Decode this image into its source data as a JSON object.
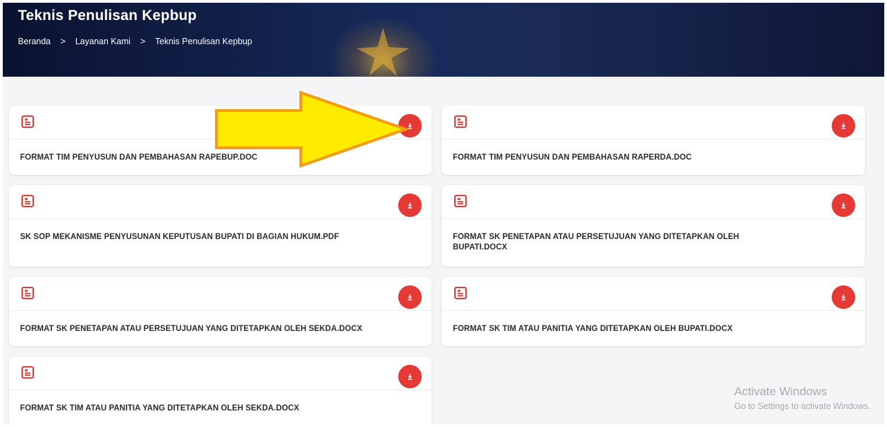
{
  "hero": {
    "title": "Teknis Penulisan Kepbup",
    "breadcrumb": [
      "Beranda",
      "Layanan Kami",
      "Teknis Penulisan Kepbup"
    ],
    "separator": ">"
  },
  "documents": [
    {
      "title": "FORMAT TIM PENYUSUN DAN PEMBAHASAN RAPEBUP.DOC",
      "icon": "document-icon",
      "action": "download-icon"
    },
    {
      "title": "FORMAT TIM PENYUSUN DAN PEMBAHASAN RAPERDA.DOC",
      "icon": "document-icon",
      "action": "download-icon"
    },
    {
      "title": "SK SOP MEKANISME PENYUSUNAN KEPUTUSAN BUPATI DI BAGIAN HUKUM.PDF",
      "icon": "document-icon",
      "action": "download-icon"
    },
    {
      "title": "FORMAT SK PENETAPAN ATAU PERSETUJUAN YANG DITETAPKAN OLEH BUPATI.DOCX",
      "icon": "document-icon",
      "action": "download-icon"
    },
    {
      "title": "FORMAT SK PENETAPAN ATAU PERSETUJUAN YANG DITETAPKAN OLEH SEKDA.DOCX",
      "icon": "document-icon",
      "action": "download-icon"
    },
    {
      "title": "FORMAT SK TIM ATAU PANITIA YANG DITETAPKAN OLEH BUPATI.DOCX",
      "icon": "document-icon",
      "action": "download-icon"
    },
    {
      "title": "FORMAT SK TIM ATAU PANITIA YANG DITETAPKAN OLEH SEKDA.DOCX",
      "icon": "document-icon",
      "action": "download-icon"
    }
  ],
  "watermark": {
    "line1": "Activate Windows",
    "line2": "Go to Settings to activate Windows."
  },
  "colors": {
    "accent": "#e53935",
    "hero_bg": "#101a3e",
    "arrow_fill": "#ffeb00",
    "arrow_stroke": "#f39c12"
  }
}
